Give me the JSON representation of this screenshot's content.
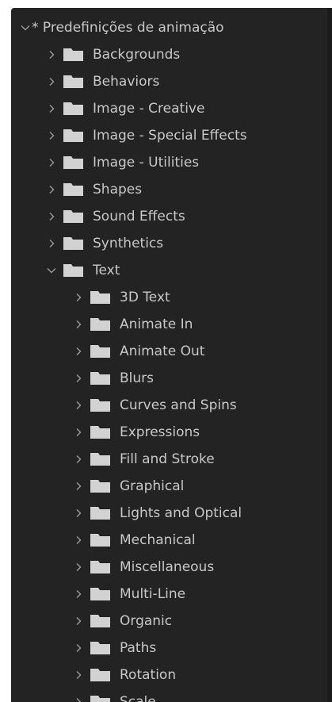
{
  "panel": {
    "root_label": "* Predefinições de animação"
  },
  "tree": {
    "level1": [
      {
        "label": "Backgrounds"
      },
      {
        "label": "Behaviors"
      },
      {
        "label": "Image - Creative"
      },
      {
        "label": "Image - Special Effects"
      },
      {
        "label": "Image - Utilities"
      },
      {
        "label": "Shapes"
      },
      {
        "label": "Sound Effects"
      },
      {
        "label": "Synthetics"
      },
      {
        "label": "Text"
      }
    ],
    "text_children": [
      {
        "label": "3D Text"
      },
      {
        "label": "Animate In"
      },
      {
        "label": "Animate Out"
      },
      {
        "label": "Blurs"
      },
      {
        "label": "Curves and Spins"
      },
      {
        "label": "Expressions"
      },
      {
        "label": "Fill and Stroke"
      },
      {
        "label": "Graphical"
      },
      {
        "label": "Lights and Optical"
      },
      {
        "label": "Mechanical"
      },
      {
        "label": "Miscellaneous"
      },
      {
        "label": "Multi-Line"
      },
      {
        "label": "Organic"
      },
      {
        "label": "Paths"
      },
      {
        "label": "Rotation"
      },
      {
        "label": "Scale"
      }
    ]
  },
  "icons": {
    "folder": "folder-icon",
    "collapsed": "chevron-right-icon",
    "expanded": "chevron-down-icon"
  },
  "colors": {
    "panel_bg": "#232323",
    "text": "#c8c8c8",
    "folder": "#d2d2d2",
    "chevron": "#9a9a9a"
  }
}
